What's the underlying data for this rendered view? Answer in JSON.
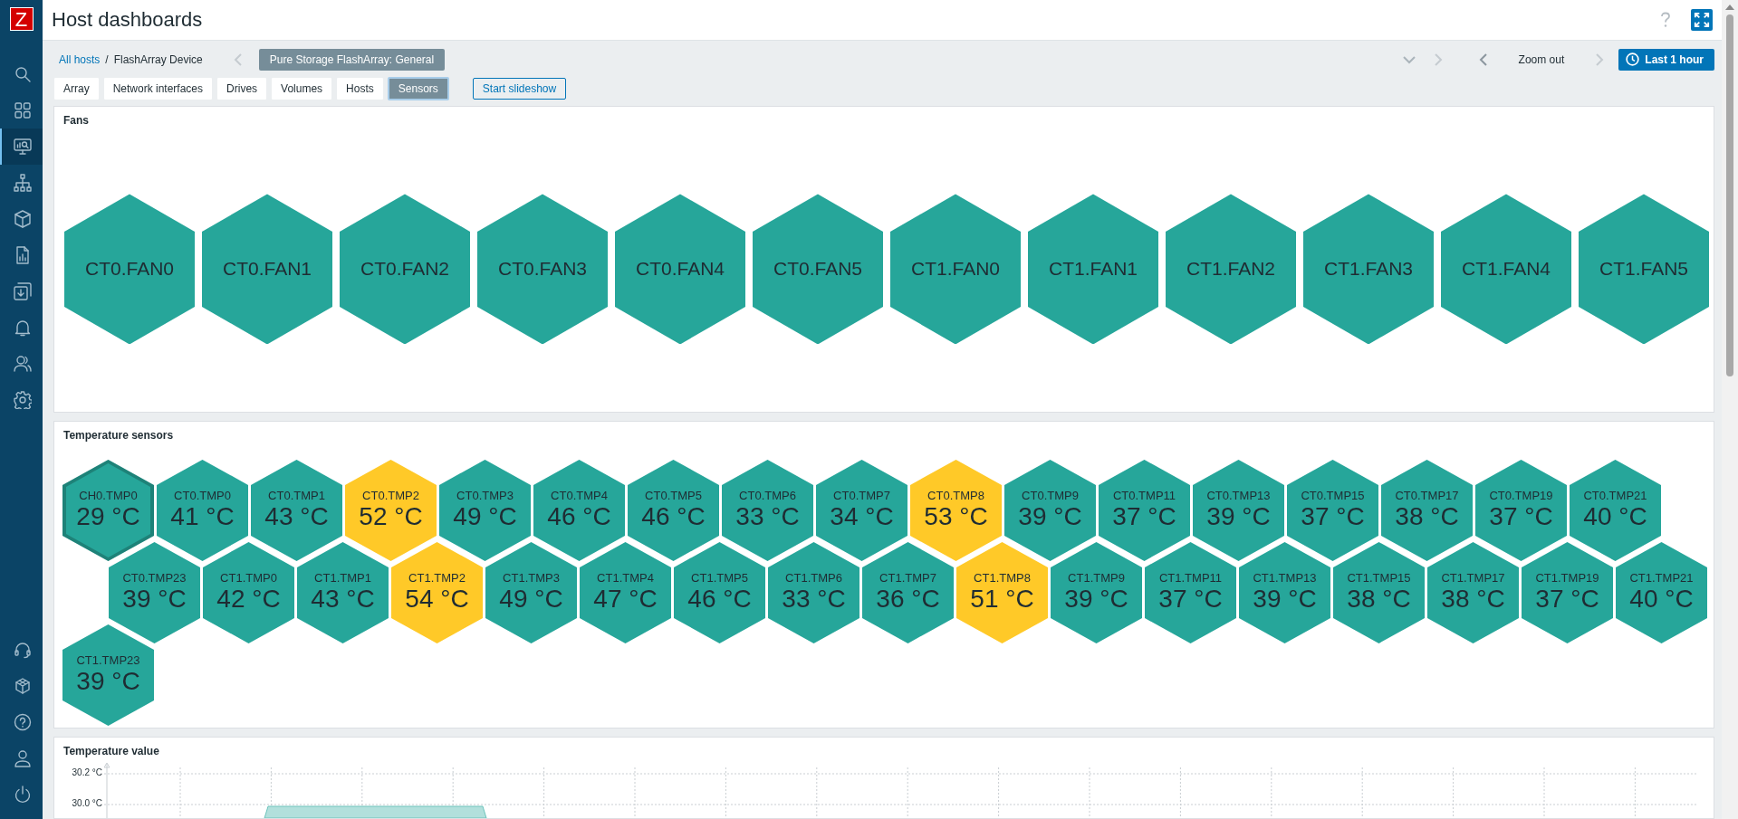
{
  "sidebar": {
    "logo": "Z",
    "items": [
      {
        "kind": "search",
        "selected": false
      },
      {
        "kind": "grid",
        "selected": false
      },
      {
        "kind": "monitor",
        "selected": true
      },
      {
        "kind": "hierarchy",
        "selected": false
      },
      {
        "kind": "box",
        "selected": false
      },
      {
        "kind": "report",
        "selected": false
      },
      {
        "kind": "download",
        "selected": false
      },
      {
        "kind": "bell",
        "selected": false
      },
      {
        "kind": "users",
        "selected": false
      },
      {
        "kind": "gear",
        "selected": false
      }
    ],
    "bottom_items": [
      {
        "kind": "headset"
      },
      {
        "kind": "cube"
      },
      {
        "kind": "help"
      },
      {
        "kind": "user"
      },
      {
        "kind": "power"
      }
    ]
  },
  "header": {
    "title": "Host dashboards"
  },
  "breadcrumb": {
    "items": [
      {
        "label": "All hosts",
        "kind": "link"
      },
      {
        "label": "FlashArray Device",
        "kind": "current"
      }
    ],
    "separator": "/"
  },
  "dashboard_selector": {
    "label": "Pure Storage FlashArray: General"
  },
  "time_controls": {
    "zoom_out": "Zoom out",
    "period": "Last 1 hour"
  },
  "tabs": [
    {
      "label": "Array",
      "selected": false
    },
    {
      "label": "Network interfaces",
      "selected": false
    },
    {
      "label": "Drives",
      "selected": false
    },
    {
      "label": "Volumes",
      "selected": false
    },
    {
      "label": "Hosts",
      "selected": false
    },
    {
      "label": "Sensors",
      "selected": true
    }
  ],
  "slideshow_button": "Start slideshow",
  "fans": {
    "title": "Fans",
    "items": [
      "CT0.FAN0",
      "CT0.FAN1",
      "CT0.FAN2",
      "CT0.FAN3",
      "CT0.FAN4",
      "CT0.FAN5",
      "CT1.FAN0",
      "CT1.FAN1",
      "CT1.FAN2",
      "CT1.FAN3",
      "CT1.FAN4",
      "CT1.FAN5"
    ]
  },
  "temperature_sensors": {
    "title": "Temperature sensors",
    "items": [
      {
        "name": "CH0.TMP0",
        "value": "29 °C",
        "color": "#26a69a",
        "selected": true
      },
      {
        "name": "CT0.TMP0",
        "value": "41 °C",
        "color": "#26a69a",
        "selected": false
      },
      {
        "name": "CT0.TMP1",
        "value": "43 °C",
        "color": "#26a69a",
        "selected": false
      },
      {
        "name": "CT0.TMP2",
        "value": "52 °C",
        "color": "#ffc928",
        "selected": false
      },
      {
        "name": "CT0.TMP3",
        "value": "49 °C",
        "color": "#26a69a",
        "selected": false
      },
      {
        "name": "CT0.TMP4",
        "value": "46 °C",
        "color": "#26a69a",
        "selected": false
      },
      {
        "name": "CT0.TMP5",
        "value": "46 °C",
        "color": "#26a69a",
        "selected": false
      },
      {
        "name": "CT0.TMP6",
        "value": "33 °C",
        "color": "#26a69a",
        "selected": false
      },
      {
        "name": "CT0.TMP7",
        "value": "34 °C",
        "color": "#26a69a",
        "selected": false
      },
      {
        "name": "CT0.TMP8",
        "value": "53 °C",
        "color": "#ffc928",
        "selected": false
      },
      {
        "name": "CT0.TMP9",
        "value": "39 °C",
        "color": "#26a69a",
        "selected": false
      },
      {
        "name": "CT0.TMP11",
        "value": "37 °C",
        "color": "#26a69a",
        "selected": false
      },
      {
        "name": "CT0.TMP13",
        "value": "39 °C",
        "color": "#26a69a",
        "selected": false
      },
      {
        "name": "CT0.TMP15",
        "value": "37 °C",
        "color": "#26a69a",
        "selected": false
      },
      {
        "name": "CT0.TMP17",
        "value": "38 °C",
        "color": "#26a69a",
        "selected": false
      },
      {
        "name": "CT0.TMP19",
        "value": "37 °C",
        "color": "#26a69a",
        "selected": false
      },
      {
        "name": "CT0.TMP21",
        "value": "40 °C",
        "color": "#26a69a",
        "selected": false
      },
      {
        "name": "CT0.TMP23",
        "value": "39 °C",
        "color": "#26a69a",
        "selected": false
      },
      {
        "name": "CT1.TMP0",
        "value": "42 °C",
        "color": "#26a69a",
        "selected": false
      },
      {
        "name": "CT1.TMP1",
        "value": "43 °C",
        "color": "#26a69a",
        "selected": false
      },
      {
        "name": "CT1.TMP2",
        "value": "54 °C",
        "color": "#ffc928",
        "selected": false
      },
      {
        "name": "CT1.TMP3",
        "value": "49 °C",
        "color": "#26a69a",
        "selected": false
      },
      {
        "name": "CT1.TMP4",
        "value": "47 °C",
        "color": "#26a69a",
        "selected": false
      },
      {
        "name": "CT1.TMP5",
        "value": "46 °C",
        "color": "#26a69a",
        "selected": false
      },
      {
        "name": "CT1.TMP6",
        "value": "33 °C",
        "color": "#26a69a",
        "selected": false
      },
      {
        "name": "CT1.TMP7",
        "value": "36 °C",
        "color": "#26a69a",
        "selected": false
      },
      {
        "name": "CT1.TMP8",
        "value": "51 °C",
        "color": "#ffc928",
        "selected": false
      },
      {
        "name": "CT1.TMP9",
        "value": "39 °C",
        "color": "#26a69a",
        "selected": false
      },
      {
        "name": "CT1.TMP11",
        "value": "37 °C",
        "color": "#26a69a",
        "selected": false
      },
      {
        "name": "CT1.TMP13",
        "value": "39 °C",
        "color": "#26a69a",
        "selected": false
      },
      {
        "name": "CT1.TMP15",
        "value": "38 °C",
        "color": "#26a69a",
        "selected": false
      },
      {
        "name": "CT1.TMP17",
        "value": "38 °C",
        "color": "#26a69a",
        "selected": false
      },
      {
        "name": "CT1.TMP19",
        "value": "37 °C",
        "color": "#26a69a",
        "selected": false
      },
      {
        "name": "CT1.TMP21",
        "value": "40 °C",
        "color": "#26a69a",
        "selected": false
      },
      {
        "name": "CT1.TMP23",
        "value": "39 °C",
        "color": "#26a69a",
        "selected": false
      }
    ]
  },
  "temperature_value": {
    "title": "Temperature value",
    "y_axis_labels": [
      "30.2 °C",
      "30.0 °C"
    ]
  }
}
